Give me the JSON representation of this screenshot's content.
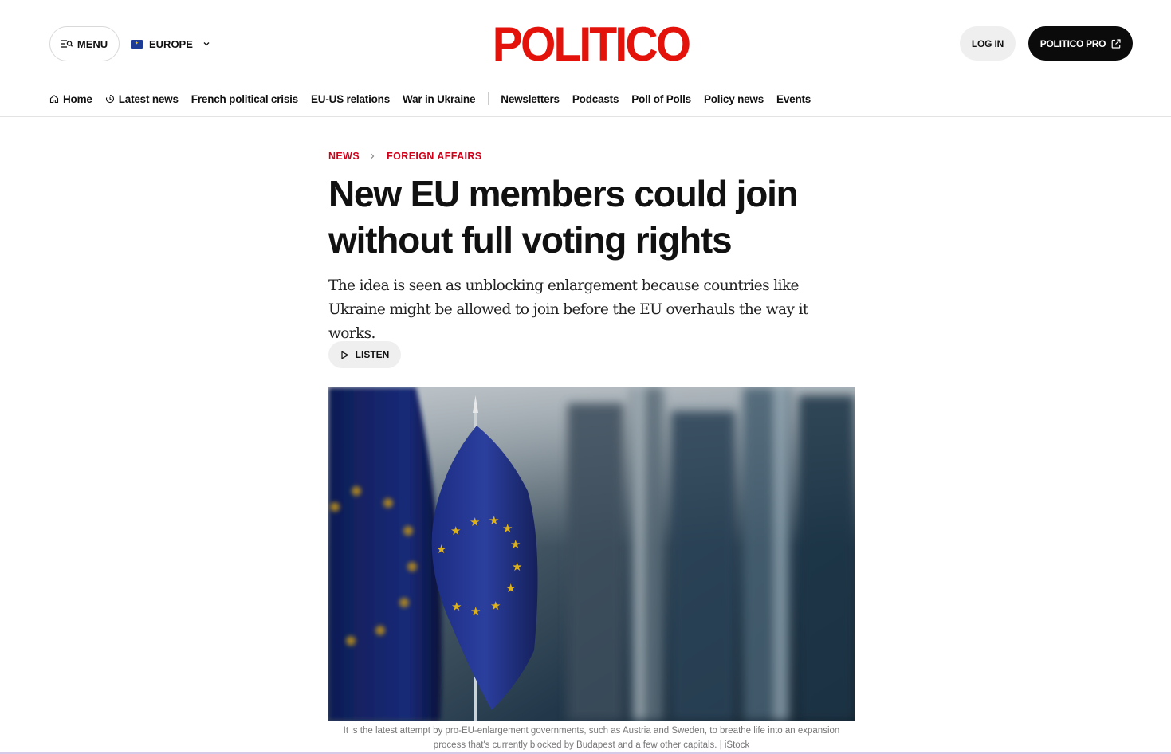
{
  "header": {
    "menu_label": "MENU",
    "edition_label": "EUROPE",
    "logo_text": "POLITICO",
    "login_label": "LOG IN",
    "pro_label": "POLITICO PRO",
    "brand_color": "#e3120b"
  },
  "nav": {
    "items": [
      {
        "label": "Home",
        "icon": "home-icon"
      },
      {
        "label": "Latest news",
        "icon": "clock-icon"
      },
      {
        "label": "French political crisis"
      },
      {
        "label": "EU-US relations"
      },
      {
        "label": "War in Ukraine"
      },
      {
        "label": "Newsletters"
      },
      {
        "label": "Podcasts"
      },
      {
        "label": "Poll of Polls"
      },
      {
        "label": "Policy news"
      },
      {
        "label": "Events"
      }
    ]
  },
  "article": {
    "breadcrumb": [
      "NEWS",
      "FOREIGN AFFAIRS"
    ],
    "headline": "New EU members could join without full voting rights",
    "dek": "The idea is seen as unblocking enlargement because countries like Ukraine might be allowed to join before the EU overhauls the way it works.",
    "listen_label": "LISTEN",
    "image_subject": "eu-flags-photo",
    "caption": "It is the latest attempt by pro-EU-enlargement governments, such as Austria and Sweden, to breathe life into an expansion process that's currently blocked by Budapest and a few other capitals. | iStock"
  }
}
